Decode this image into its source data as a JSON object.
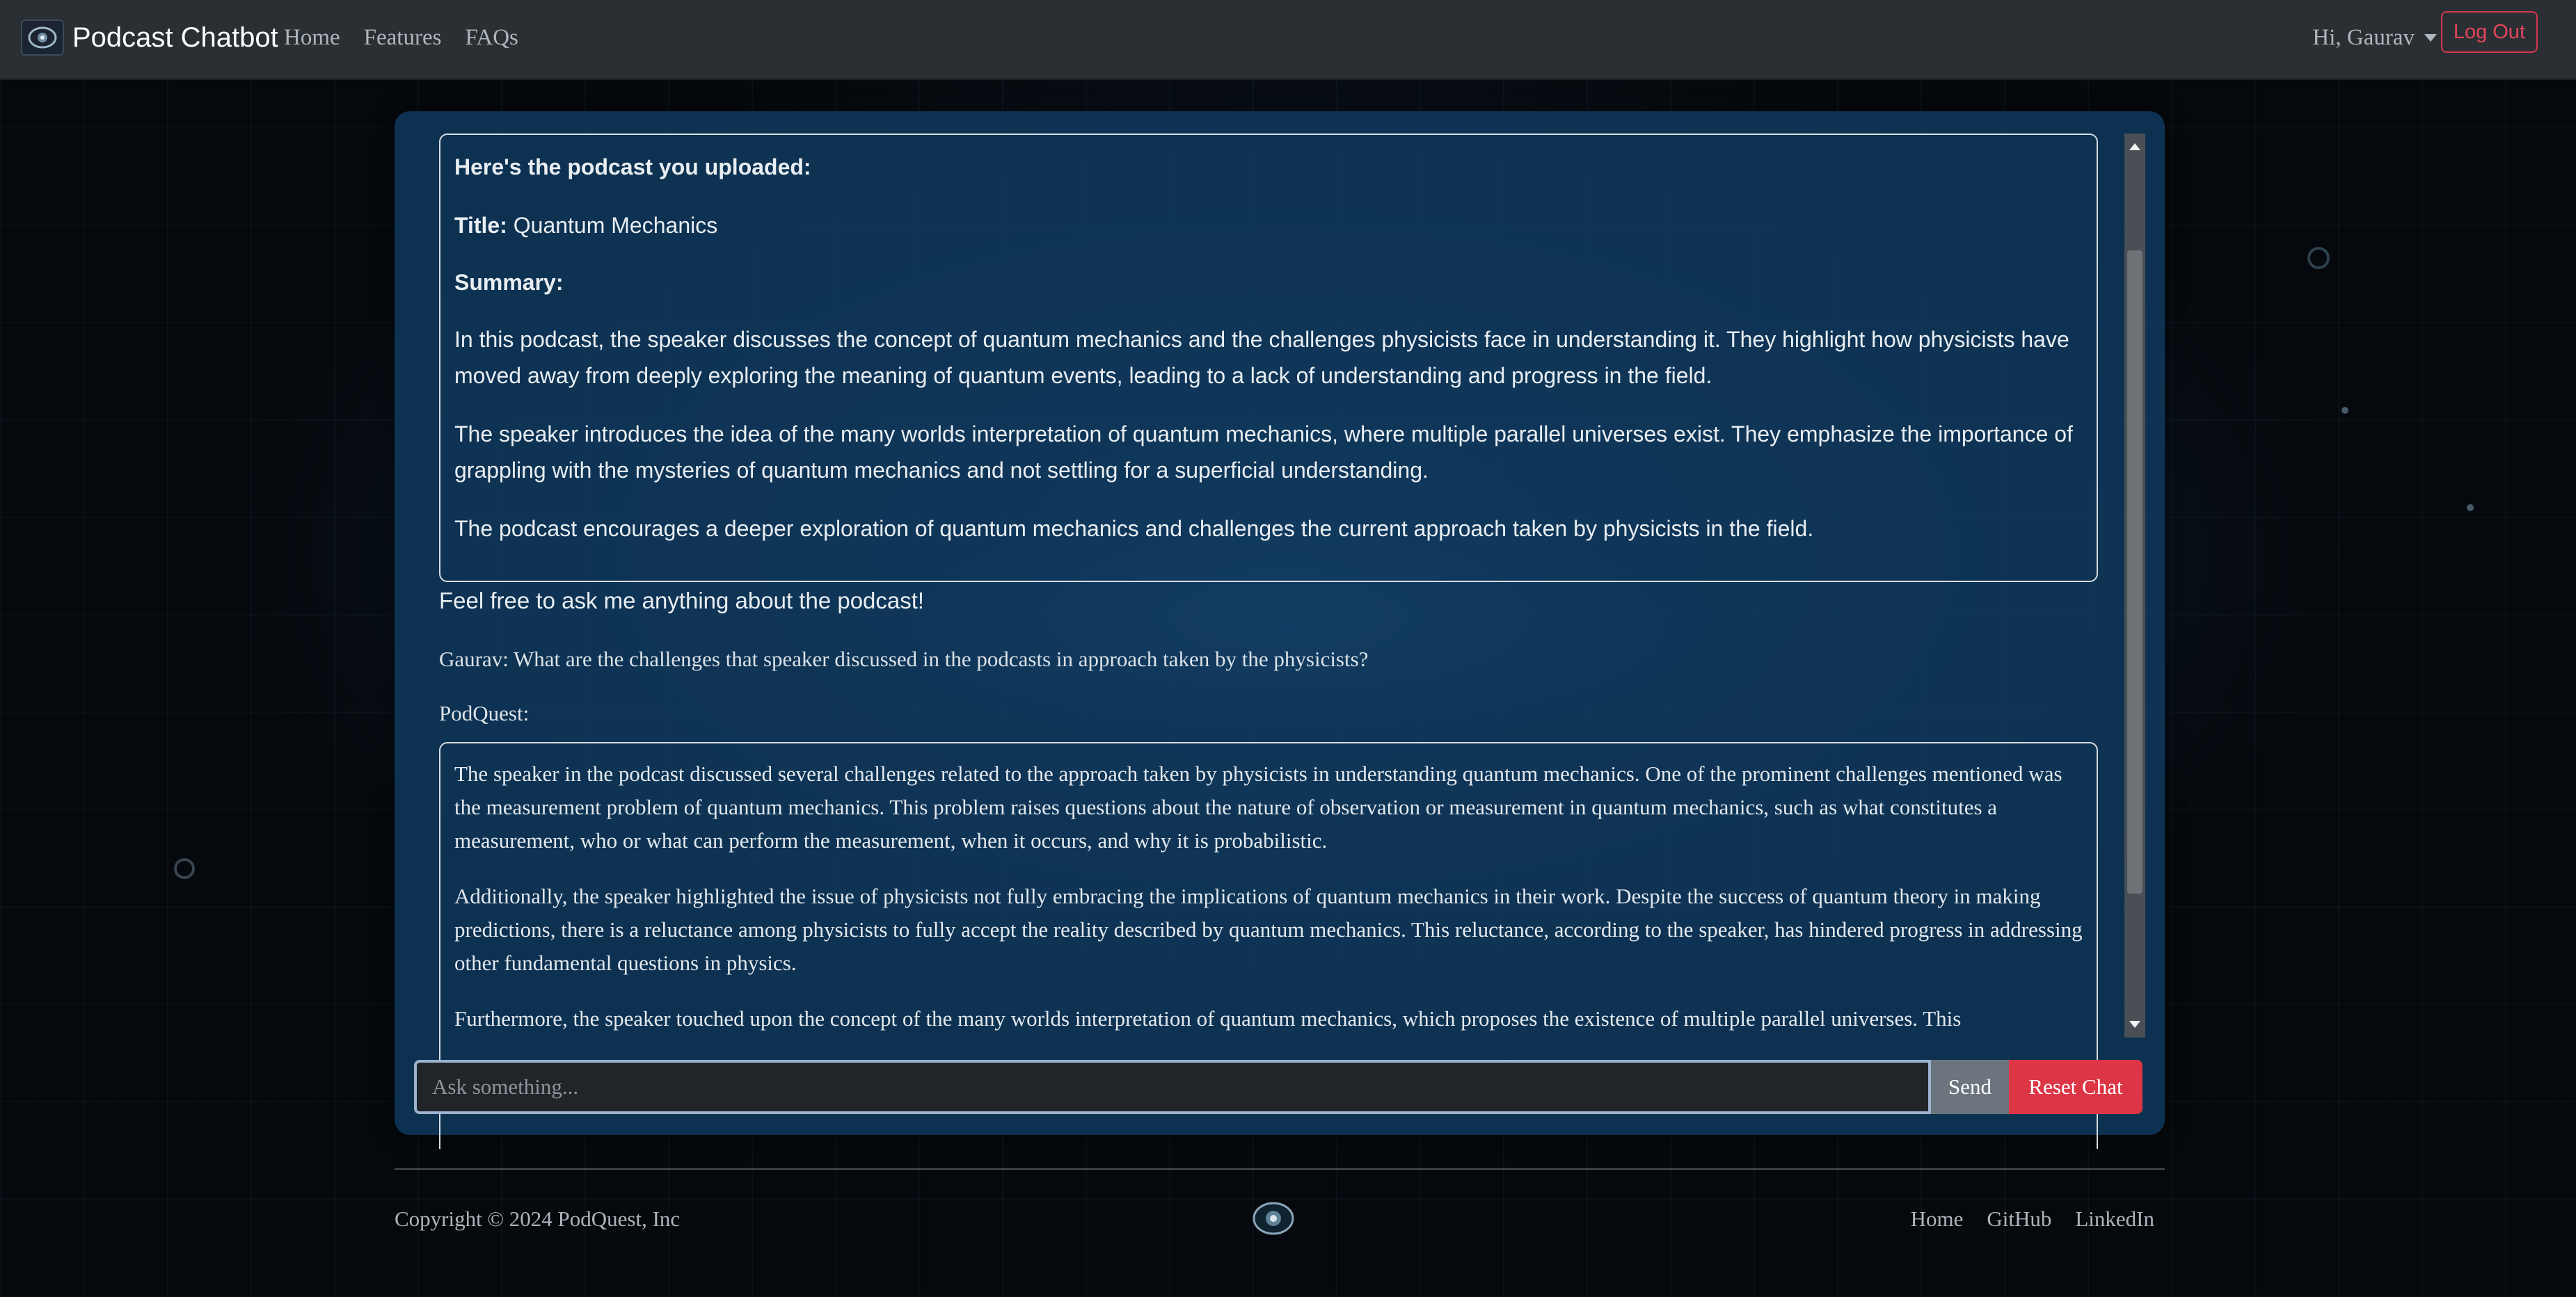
{
  "navbar": {
    "brand": "Podcast Chatbot",
    "links": [
      "Home",
      "Features",
      "FAQs"
    ],
    "greeting": "Hi, Gaurav",
    "logout_label": "Log Out"
  },
  "chat": {
    "upload_box": {
      "heading": "Here's the podcast you uploaded:",
      "title_label": "Title:",
      "title_value": "Quantum Mechanics",
      "summary_label": "Summary:",
      "paragraphs": [
        "In this podcast, the speaker discusses the concept of quantum mechanics and the challenges physicists face in understanding it. They highlight how physicists have moved away from deeply exploring the meaning of quantum events, leading to a lack of understanding and progress in the field.",
        "The speaker introduces the idea of the many worlds interpretation of quantum mechanics, where multiple parallel universes exist. They emphasize the importance of grappling with the mysteries of quantum mechanics and not settling for a superficial understanding.",
        "The podcast encourages a deeper exploration of quantum mechanics and challenges the current approach taken by physicists in the field."
      ]
    },
    "invite_text": "Feel free to ask me anything about the podcast!",
    "user_message": "Gaurav: What are the challenges that speaker discussed in the podcasts in approach taken by the physicists?",
    "bot_label": "PodQuest:",
    "bot_paragraphs": [
      "The speaker in the podcast discussed several challenges related to the approach taken by physicists in understanding quantum mechanics. One of the prominent challenges mentioned was the measurement problem of quantum mechanics. This problem raises questions about the nature of observation or measurement in quantum mechanics, such as what constitutes a measurement, who or what can perform the measurement, when it occurs, and why it is probabilistic.",
      "Additionally, the speaker highlighted the issue of physicists not fully embracing the implications of quantum mechanics in their work. Despite the success of quantum theory in making predictions, there is a reluctance among physicists to fully accept the reality described by quantum mechanics. This reluctance, according to the speaker, has hindered progress in addressing other fundamental questions in physics.",
      "Furthermore, the speaker touched upon the concept of the many worlds interpretation of quantum mechanics, which proposes the existence of multiple parallel universes. This"
    ],
    "input_placeholder": "Ask something...",
    "send_label": "Send",
    "reset_label": "Reset Chat"
  },
  "footer": {
    "copyright": "Copyright © 2024 PodQuest, Inc",
    "links": [
      "Home",
      "GitHub",
      "LinkedIn"
    ]
  },
  "colors": {
    "navbar": "#2a2f34",
    "card": "#103a60",
    "danger": "#dc3545",
    "secondary": "#6c757d"
  },
  "icons": [
    "podquest-logo-icon",
    "dropdown-caret-icon",
    "scroll-up-arrow-icon",
    "scroll-down-arrow-icon"
  ]
}
